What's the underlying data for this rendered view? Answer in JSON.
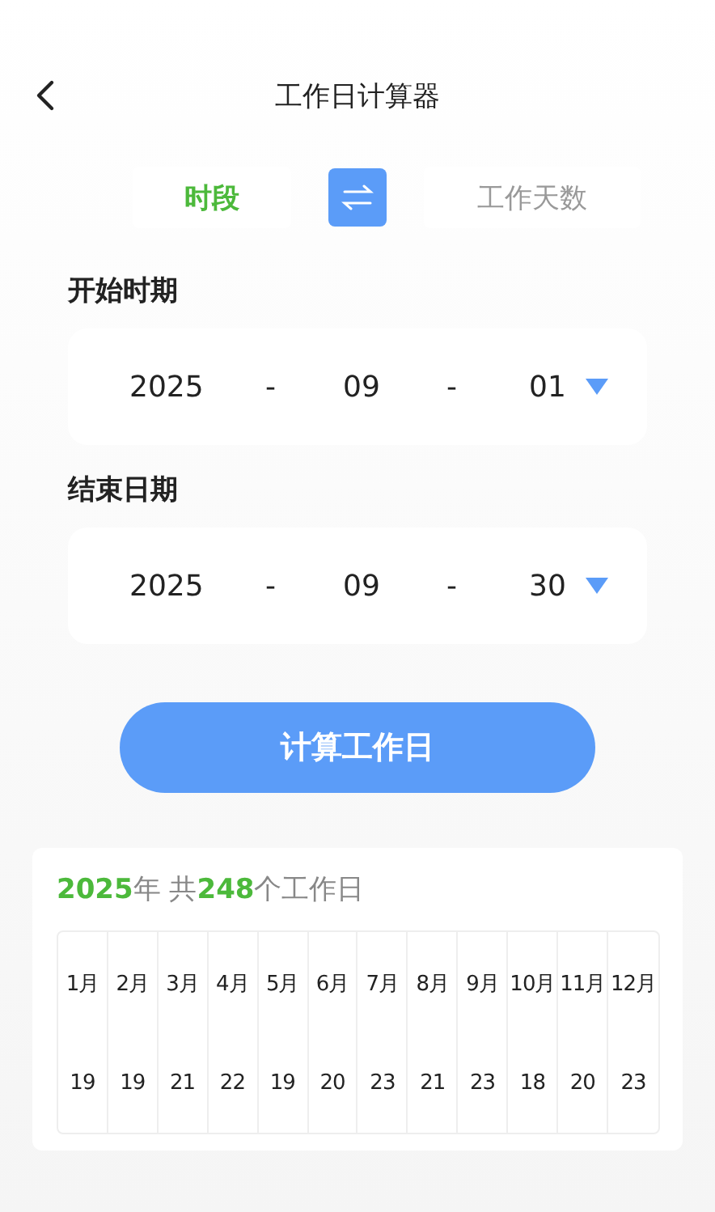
{
  "header": {
    "title": "工作日计算器"
  },
  "tabs": [
    {
      "label": "时段",
      "selected": true
    },
    {
      "label": "工作天数",
      "selected": false
    }
  ],
  "dates": [
    {
      "label": "开始时期",
      "year": "2025",
      "sep1": "-",
      "month": "09",
      "sep2": "-",
      "day": "01"
    },
    {
      "label": "结束日期",
      "year": "2025",
      "sep1": "-",
      "month": "09",
      "sep2": "-",
      "day": "30"
    }
  ],
  "calculate_button": "计算工作日",
  "result": {
    "summary": "**2025**年 共**248**个工作日",
    "months": [
      {
        "month": "1月",
        "days": "19"
      },
      {
        "month": "2月",
        "days": "19"
      },
      {
        "month": "3月",
        "days": "21"
      },
      {
        "month": "4月",
        "days": "22"
      },
      {
        "month": "5月",
        "days": "19"
      },
      {
        "month": "6月",
        "days": "20"
      },
      {
        "month": "7月",
        "days": "23"
      },
      {
        "month": "8月",
        "days": "21"
      },
      {
        "month": "9月",
        "days": "23"
      },
      {
        "month": "10月",
        "days": "18"
      },
      {
        "month": "11月",
        "days": "20"
      },
      {
        "month": "12月",
        "days": "23"
      }
    ]
  }
}
